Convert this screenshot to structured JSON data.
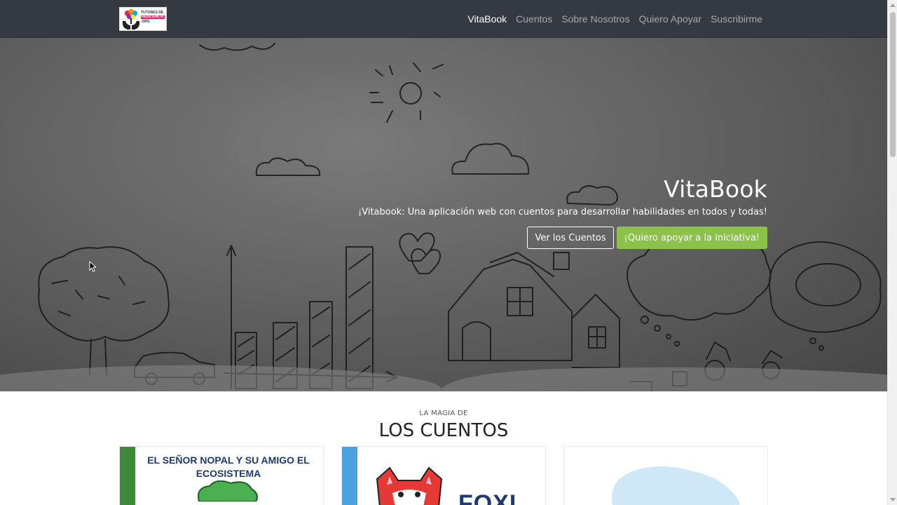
{
  "navbar": {
    "logo": {
      "alt": "Tutores de Resiliencia .org",
      "line1": "TUTORES DE",
      "line2": "RESILIENCIA",
      "line3": ".ORG"
    },
    "links": [
      {
        "label": "VitaBook",
        "active": true
      },
      {
        "label": "Cuentos",
        "active": false
      },
      {
        "label": "Sobre Nosotros",
        "active": false
      },
      {
        "label": "Quiero Apoyar",
        "active": false
      },
      {
        "label": "Suscribirme",
        "active": false
      }
    ]
  },
  "hero": {
    "title": "VitaBook",
    "subtitle": "¡Vitabook: Una aplicación web con cuentos para desarrollar habilidades en todos y todas!",
    "primary_button": "Ver los Cuentos",
    "secondary_button": "¡Quiero apoyar a la iniciativa!"
  },
  "stories_section": {
    "eyebrow": "LA MAGIA DE",
    "title": "LOS CUENTOS",
    "cards": [
      {
        "title": "EL SEÑOR NOPAL Y SU AMIGO EL ECOSISTEMA",
        "accent": "#3f8a3a"
      },
      {
        "title": "FOXI",
        "accent": "#4aa3df"
      },
      {
        "title": "",
        "accent": "#cfe8f7"
      }
    ]
  },
  "colors": {
    "navbar_bg": "#343a40",
    "green_button": "#8bc34a",
    "title_blue": "#1e3a6e"
  },
  "icons": [
    "mouse-cursor-icon"
  ]
}
